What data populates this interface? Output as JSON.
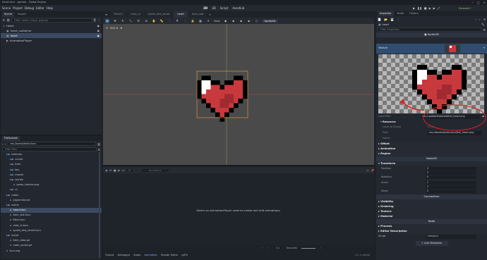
{
  "window": {
    "title": "heart.tscn - gamea - Godot Engine",
    "controls": [
      "–",
      "□",
      "×"
    ]
  },
  "menu": {
    "items": [
      "Scene",
      "Project",
      "Debug",
      "Editor",
      "Help"
    ]
  },
  "workspaces": {
    "items": [
      "2D",
      "3D",
      "Script",
      "AssetLib"
    ],
    "active": "2D"
  },
  "run": {
    "icons": [
      "▶",
      "❚❚",
      "■",
      "▶",
      "▶",
      "⤢"
    ],
    "renderer": "Forward+"
  },
  "scene_dock": {
    "tabs": [
      "Scene",
      "Import"
    ],
    "filter_placeholder": "Filter: name, t:type, g:group",
    "nodes": [
      {
        "label": "Heart",
        "indent": 0
      },
      {
        "label": "heart_container",
        "indent": 1
      },
      {
        "label": "heart",
        "indent": 1,
        "selected": true
      },
      {
        "label": "AnimationPlayer",
        "indent": 1
      }
    ]
  },
  "filesystem": {
    "tab": "FileSystem",
    "path": "res://scene/heart.tscn",
    "filter_placeholder": "Filter Files",
    "items": [
      {
        "label": "textures",
        "indent": 1,
        "folder": true
      },
      {
        "label": "cursor",
        "indent": 2,
        "folder": true
      },
      {
        "label": "item",
        "indent": 2,
        "folder": true
      },
      {
        "label": "key",
        "indent": 2,
        "folder": true
      },
      {
        "label": "mouse",
        "indent": 2,
        "folder": true
      },
      {
        "label": "terrain",
        "indent": 2,
        "folder": true
      },
      {
        "label": "grass_islands.png",
        "indent": 3
      },
      {
        "label": "ui",
        "indent": 2,
        "folder": true
      },
      {
        "label": "notes",
        "indent": 1,
        "folder": true
      },
      {
        "label": "playerinfo.txt",
        "indent": 2
      },
      {
        "label": "scene",
        "indent": 1,
        "folder": true
      },
      {
        "label": "heart.tscn",
        "indent": 2,
        "selected": true
      },
      {
        "label": "item_slot.tscn",
        "indent": 2
      },
      {
        "label": "Main.tscn",
        "indent": 2
      },
      {
        "label": "mob_ui.tscn",
        "indent": 2
      },
      {
        "label": "sprite_test_sheet.tscn",
        "indent": 2
      },
      {
        "label": "script",
        "indent": 1,
        "folder": true
      },
      {
        "label": "item_data.gd",
        "indent": 2
      },
      {
        "label": "main_script.gd",
        "indent": 2
      },
      {
        "label": "icon.svg",
        "indent": 1
      }
    ]
  },
  "scene_tabs": {
    "items": [
      "Main(*)",
      "mob_ui",
      "sprite_test_sheet",
      "heart",
      "item_slot"
    ],
    "active": "heart",
    "more": "»"
  },
  "toolbar2d": {
    "view_label": "View",
    "sprite_label": "Sprite2D"
  },
  "viewport": {
    "zoom": "204 %"
  },
  "animation": {
    "name_placeholder": "Animation",
    "message": "Select an AnimationPlayer node to create and edit animations.",
    "time": "0",
    "snap": "0.1",
    "fps_label": "Seconds"
  },
  "bottom_panel": {
    "tabs": [
      "Output",
      "Debugger",
      "Audio",
      "Animation",
      "Shader Editor",
      "gdTk"
    ],
    "active": "Animation",
    "version": "4.2.1.stable"
  },
  "inspector": {
    "tabs": [
      "Inspector",
      "Node",
      "History"
    ],
    "node_name": "heart",
    "filter_placeholder": "Filter Properties",
    "class": "Sprite2D",
    "texture_label": "Texture",
    "load_path_label": "Load Path",
    "load_path_value": "res://.godot/imported/full_heart.png",
    "resource_label": "Resource",
    "local_to_scene_label": "Local to Scene",
    "path_label": "Path",
    "path_value": "res://assets/textures/ui/full_heart.png",
    "name_label": "Name",
    "on_label": "On",
    "sections": [
      "Offset",
      "Animation",
      "Region"
    ],
    "node2d": "Node2D",
    "transform_label": "Transform",
    "position_label": "Position",
    "rotation_label": "Rotation",
    "scale_label": "Scale",
    "skew_label": "Skew",
    "canvasitem": "CanvasItem",
    "canvas_sections": [
      "Visibility",
      "Ordering",
      "Texture",
      "Material"
    ],
    "node": "Node",
    "node_sections": [
      "Process",
      "Editor Description"
    ],
    "script_label": "Script",
    "script_value": "<empty>",
    "add_metadata": "Add Metadata",
    "values": {
      "pos_x": "0",
      "pos_y": "0",
      "rot": "0",
      "sx": "2",
      "sy": "2",
      "skew": "0"
    }
  },
  "colors": {
    "heart_red": "#c8393e",
    "heart_dark": "#a02a30",
    "selection": "#3a4a61",
    "accent": "#7fb0ff",
    "annotation": "#e0201f"
  }
}
